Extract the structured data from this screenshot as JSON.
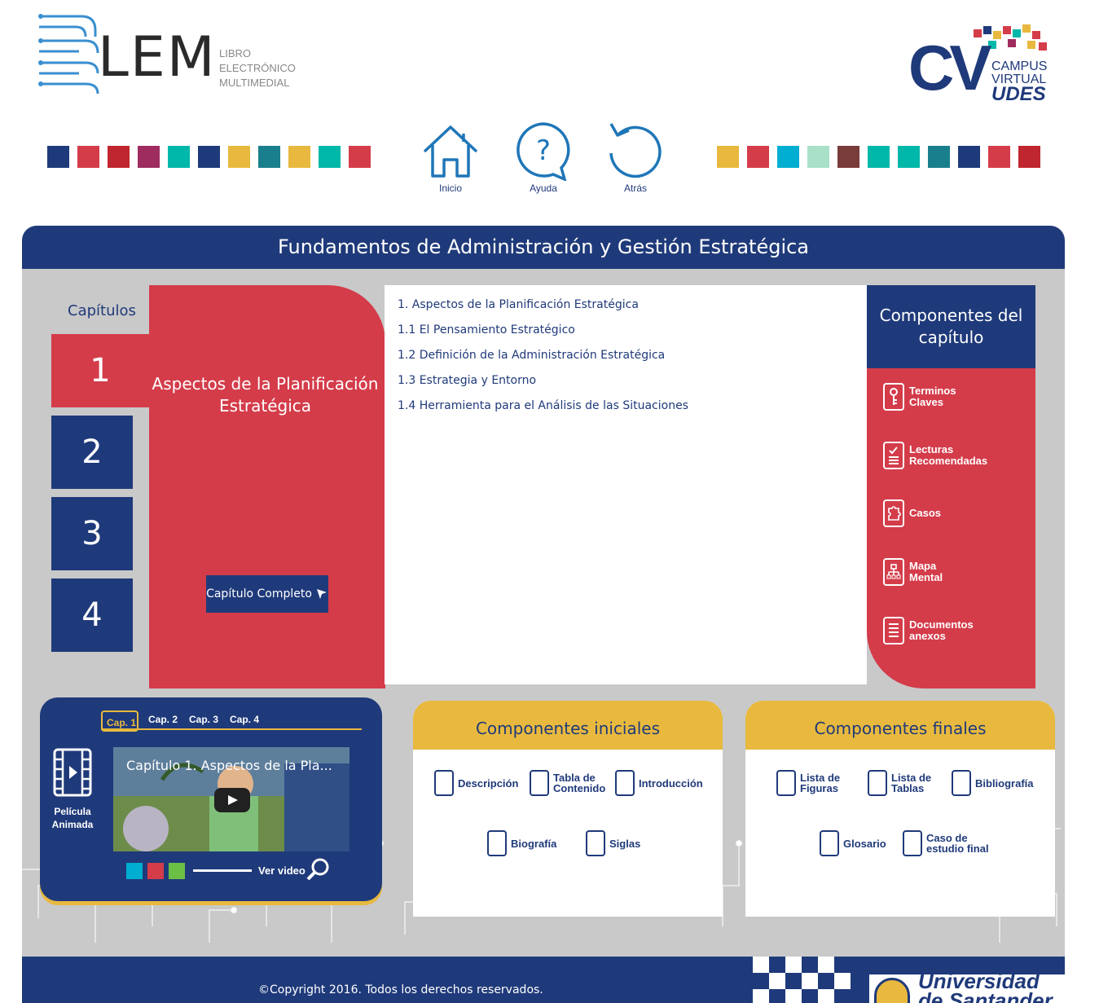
{
  "header": {
    "logo_left": {
      "mark": "LEM",
      "line1": "LIBRO",
      "line2": "ELECTRÓNICO",
      "line3": "MULTIMEDIAL"
    },
    "logo_right": {
      "mark": "CV",
      "line1": "CAMPUS",
      "line2": "VIRTUAL",
      "line3": "UDES"
    },
    "swatches_left": [
      "#1f3a7a",
      "#d43c4a",
      "#c0262f",
      "#9e2c5e",
      "#00b8a9",
      "#1f3a7a",
      "#e8b93e",
      "#1a7f8c",
      "#e8b93e",
      "#00b8a9",
      "#d43c4a"
    ],
    "swatches_right": [
      "#e8b93e",
      "#d43c4a",
      "#00aed1",
      "#a8e0c8",
      "#7a3b3b",
      "#00b8a9",
      "#00b8a9",
      "#1a7f8c",
      "#1f3a7a",
      "#d43c4a",
      "#c0262f"
    ],
    "nav": {
      "home": {
        "label": "Inicio",
        "icon": "house-icon"
      },
      "help": {
        "label": "Ayuda",
        "icon": "help-bubble-icon"
      },
      "back": {
        "label": "Atrás",
        "icon": "undo-arrow-icon"
      }
    }
  },
  "panel": {
    "title": "Fundamentos de Administración y Gestión Estratégica",
    "chapters_label": "Capítulos",
    "chapters": [
      "1",
      "2",
      "3",
      "4"
    ],
    "active_chapter": "1",
    "chapter_title": "Aspectos de la Planificación Estratégica",
    "full_chapter_button": "Capítulo Completo",
    "toc": [
      "1. Aspectos de la Planificación Estratégica",
      "1.1 El Pensamiento Estratégico",
      "1.2 Definición de la Administración Estratégica",
      "1.3 Estrategia y Entorno",
      "1.4 Herramienta para el Análisis de las Situaciones"
    ],
    "chapter_components": {
      "title": "Componentes del capítulo",
      "items": [
        {
          "l1": "Terminos",
          "l2": "Claves",
          "icon": "key-icon"
        },
        {
          "l1": "Lecturas",
          "l2": "Recomendadas",
          "icon": "checklist-icon"
        },
        {
          "l1": "Casos",
          "l2": "",
          "icon": "puzzle-icon"
        },
        {
          "l1": "Mapa",
          "l2": "Mental",
          "icon": "org-chart-icon"
        },
        {
          "l1": "Documentos",
          "l2": "anexos",
          "icon": "document-icon"
        }
      ]
    }
  },
  "video": {
    "tabs": [
      "Cap. 1",
      "Cap. 2",
      "Cap. 3",
      "Cap. 4"
    ],
    "film_label_1": "Película",
    "film_label_2": "Animada",
    "video_title": "Capítulo 1. Aspectos de la Pla...",
    "dot_colors": [
      "#00aed1",
      "#d43c4a",
      "#6cbf45"
    ],
    "ver_video": "Ver video"
  },
  "initial_components": {
    "title": "Componentes iniciales",
    "items": [
      {
        "l1": "Descripción",
        "l2": ""
      },
      {
        "l1": "Tabla de",
        "l2": "Contenido"
      },
      {
        "l1": "Introducción",
        "l2": ""
      },
      {
        "l1": "Biografía",
        "l2": ""
      },
      {
        "l1": "Siglas",
        "l2": ""
      }
    ]
  },
  "final_components": {
    "title": "Componentes finales",
    "items": [
      {
        "l1": "Lista de",
        "l2": "Figuras"
      },
      {
        "l1": "Lista de",
        "l2": "Tablas"
      },
      {
        "l1": "Bibliografía",
        "l2": ""
      },
      {
        "l1": "Glosario",
        "l2": ""
      },
      {
        "l1": "Caso de",
        "l2": "estudio final"
      }
    ]
  },
  "footer": {
    "copyright": "©Copyright 2016. Todos los derechos reservados.",
    "university": "Universidad de Santander"
  },
  "colors": {
    "navy": "#1f3a7a",
    "red": "#d43c4a",
    "gold": "#e8b93e",
    "gray": "#c9c9c9"
  }
}
